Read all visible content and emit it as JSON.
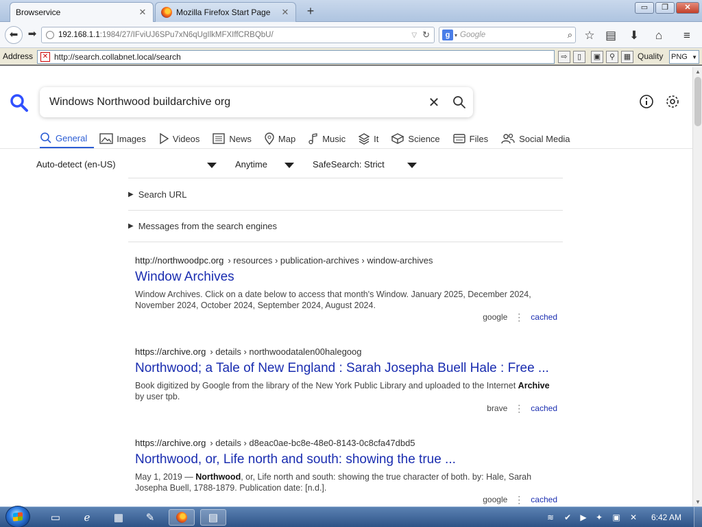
{
  "browser": {
    "tabs": [
      {
        "label": "Browservice",
        "active": true
      },
      {
        "label": "Mozilla Firefox Start Page",
        "active": false
      }
    ],
    "new_tab_icon": "plus-icon",
    "url_host": "192.168.1.1",
    "url_path": ":1984/27/IFviUJ6SPu7xN6qUgIlkMFXIffCRBQbU/",
    "search_placeholder": "Google",
    "search_engine_badge": "g",
    "window_controls": {
      "minimize": "▭",
      "maximize": "❐",
      "close": "✕"
    }
  },
  "addressbar": {
    "label": "Address",
    "url": "http://search.collabnet.local/search",
    "quality_label": "Quality",
    "quality_value": "PNG"
  },
  "search": {
    "query": "Windows Northwood buildarchive org",
    "categories": [
      {
        "label": "General",
        "icon": "search-icon",
        "active": true
      },
      {
        "label": "Images",
        "icon": "image-icon"
      },
      {
        "label": "Videos",
        "icon": "play-icon"
      },
      {
        "label": "News",
        "icon": "newspaper-icon"
      },
      {
        "label": "Map",
        "icon": "map-pin-icon"
      },
      {
        "label": "Music",
        "icon": "music-note-icon"
      },
      {
        "label": "It",
        "icon": "layers-icon"
      },
      {
        "label": "Science",
        "icon": "cube-icon"
      },
      {
        "label": "Files",
        "icon": "file-icon"
      },
      {
        "label": "Social Media",
        "icon": "people-icon"
      }
    ],
    "filters": {
      "language": "Auto-detect (en-US)",
      "time": "Anytime",
      "safesearch": "SafeSearch: Strict"
    },
    "search_url_label": "Search URL",
    "messages_label": "Messages from the search engines",
    "results": [
      {
        "url": "http://northwoodpc.org",
        "path": "› resources › publication-archives › window-archives",
        "title": "Window Archives",
        "snippet": "Window Archives. Click on a date below to access that month's Window. January 2025, December 2024, November 2024, October 2024, September 2024, August 2024.",
        "engine": "google",
        "cached": "cached"
      },
      {
        "url": "https://archive.org",
        "path": "› details › northwoodatalen00halegoog",
        "title": "Northwood; a Tale of New England : Sarah Josepha Buell Hale : Free ...",
        "snippet_pre": "Book digitized by Google from the library of the New York Public Library and uploaded to the Internet ",
        "snippet_bold": "Archive",
        "snippet_post": " by user tpb.",
        "engine": "brave",
        "cached": "cached"
      },
      {
        "url": "https://archive.org",
        "path": "› details › d8eac0ae-bc8e-48e0-8143-0c8cfa47dbd5",
        "title": "Northwood, or, Life north and south: showing the true ...",
        "snippet_pre": "May 1, 2019 — ",
        "snippet_bold": "Northwood",
        "snippet_post": ", or, Life north and south: showing the true character of both. by: Hale, Sarah Josepha Buell, 1788-1879. Publication date: [n.d.].",
        "engine": "google",
        "cached": "cached"
      }
    ]
  },
  "taskbar": {
    "clock": "6:42 AM"
  }
}
